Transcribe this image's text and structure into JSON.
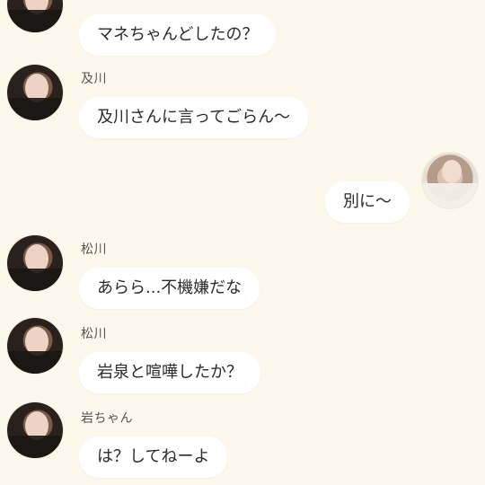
{
  "colors": {
    "background": "#fcf8ec",
    "bubble": "#ffffff",
    "text": "#2b2b2b",
    "name_text": "#555555"
  },
  "messages": [
    {
      "sender": "",
      "text": "マネちゃんどしたの？",
      "side": "left"
    },
    {
      "sender": "及川",
      "text": "及川さんに言ってごらん〜",
      "side": "left"
    },
    {
      "sender": "",
      "text": "別に〜",
      "side": "right"
    },
    {
      "sender": "松川",
      "text": "あらら...不機嫌だな",
      "side": "left"
    },
    {
      "sender": "松川",
      "text": "岩泉と喧嘩したか？",
      "side": "left"
    },
    {
      "sender": "岩ちゃん",
      "text": "は？してねーよ",
      "side": "left"
    }
  ]
}
